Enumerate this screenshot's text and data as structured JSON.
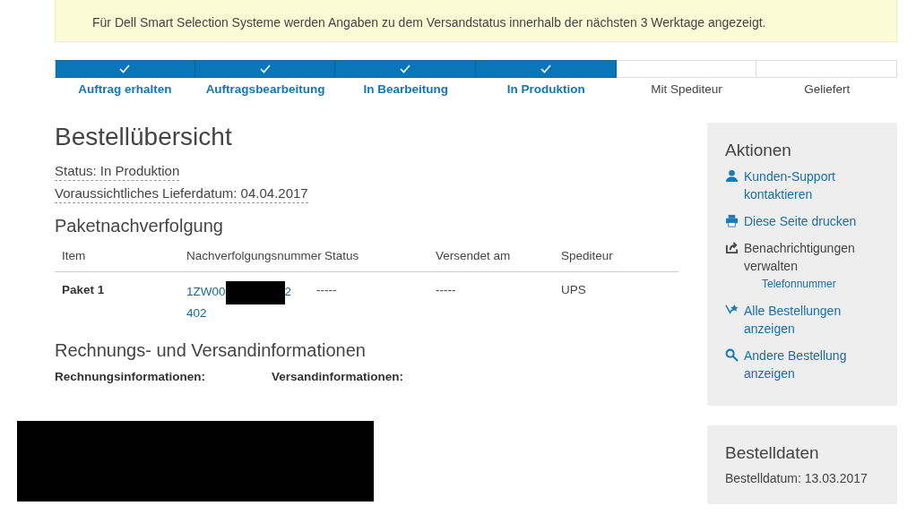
{
  "notice": "Für Dell Smart Selection Systeme werden Angaben zu dem Versandstatus innerhalb der nächsten 3 Werktage angezeigt.",
  "progress": [
    {
      "label": "Auftrag erhalten",
      "done": true
    },
    {
      "label": "Auftragsbearbeitung",
      "done": true
    },
    {
      "label": "In Bearbeitung",
      "done": true
    },
    {
      "label": "In Produktion",
      "done": true
    },
    {
      "label": "Mit Spediteur",
      "done": false
    },
    {
      "label": "Geliefert",
      "done": false
    }
  ],
  "title": "Bestellübersicht",
  "status": "Status: In Produktion",
  "delivery": "Voraussichtliches Lieferdatum: 04.04.2017",
  "tracking": {
    "title": "Paketnachverfolgung",
    "columns": [
      "Item",
      "Nachverfolgungsnummer",
      "Status",
      "Versendet am",
      "Spediteur"
    ],
    "rows": [
      {
        "item": "Paket 1",
        "number_start": "1ZW00",
        "number_end": "2",
        "number_line2": "402",
        "status": "-----",
        "shipped": "-----",
        "carrier": "UPS"
      }
    ]
  },
  "billing": {
    "title": "Rechnungs- und Versandinformationen",
    "billing_label": "Rechnungsinformationen:",
    "shipping_label": "Versandinformationen:"
  },
  "actions": {
    "title": "Aktionen",
    "items": [
      {
        "kind": "person",
        "label": "Kunden-Support kontaktieren",
        "link": true
      },
      {
        "kind": "print",
        "label": "Diese Seite drucken",
        "link": true
      },
      {
        "kind": "share",
        "label": "Benachrichtigungen verwalten",
        "link": false,
        "sub": "Telefonnummer"
      },
      {
        "kind": "orders",
        "label": "Alle Bestellungen anzeigen",
        "link": true
      },
      {
        "kind": "search",
        "label": "Andere Bestellung anzeigen",
        "link": true
      }
    ]
  },
  "order_data": {
    "title": "Bestelldaten",
    "date": "Bestelldatum: 13.03.2017"
  }
}
